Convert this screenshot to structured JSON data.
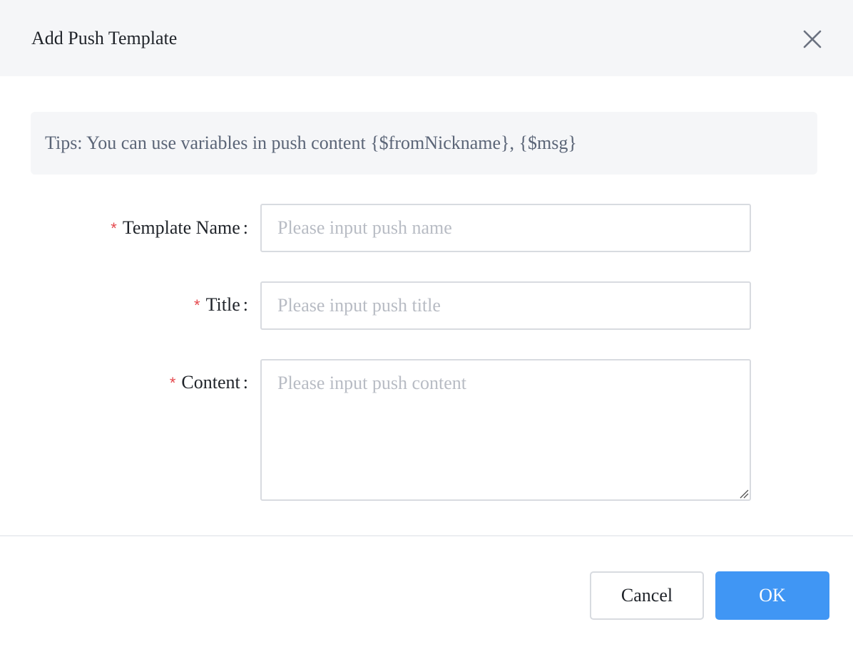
{
  "dialog": {
    "title": "Add Push Template",
    "close_icon": "close-icon"
  },
  "tips": {
    "text": "Tips: You can use variables in push content {$fromNickname}, {$msg}"
  },
  "form": {
    "required_mark": "*",
    "colon": ":",
    "template_name": {
      "label": "Template Name",
      "value": "",
      "placeholder": "Please input push name"
    },
    "title": {
      "label": "Title",
      "value": "",
      "placeholder": "Please input push title"
    },
    "content": {
      "label": "Content",
      "value": "",
      "placeholder": "Please input push content"
    }
  },
  "footer": {
    "cancel_label": "Cancel",
    "ok_label": "OK"
  },
  "colors": {
    "primary": "#4096f4",
    "required": "#e5484d",
    "header_bg": "#f5f6f8"
  }
}
